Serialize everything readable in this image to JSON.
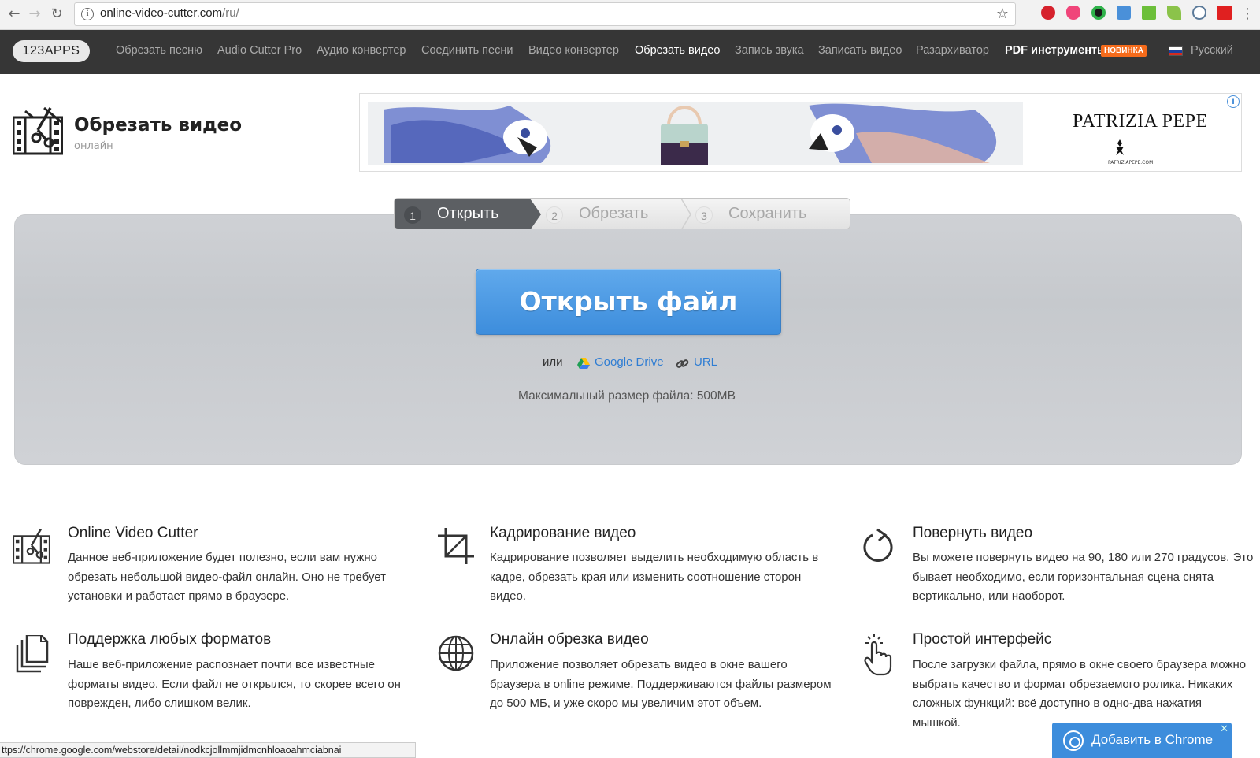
{
  "browser": {
    "url_host": "online-video-cutter.com",
    "url_path": "/ru/"
  },
  "sitenav": {
    "logo": "123APPS",
    "links": [
      "Обрезать песню",
      "Audio Cutter Pro",
      "Аудио конвертер",
      "Соединить песни",
      "Видео конвертер",
      "Обрезать видео",
      "Запись звука",
      "Записать видео",
      "Разархиватор",
      "PDF инструменты"
    ],
    "active_index": 5,
    "new_badge": "НОВИНКА",
    "language": "Русский"
  },
  "header": {
    "title": "Обрезать видео",
    "subtitle": "онлайн"
  },
  "ad": {
    "brand": "PATRIZIA PEPE",
    "brand_url": "PATRIZIAPEPE.COM"
  },
  "steps": [
    {
      "num": "1",
      "label": "Открыть"
    },
    {
      "num": "2",
      "label": "Обрезать"
    },
    {
      "num": "3",
      "label": "Сохранить"
    }
  ],
  "main": {
    "open_button": "Открыть файл",
    "or": "или",
    "google_drive": "Google Drive",
    "url": "URL",
    "max_size": "Максимальный размер файла: 500MB"
  },
  "features": [
    {
      "title": "Online Video Cutter",
      "icon": "film-scissors-icon",
      "text": "Данное веб-приложение будет полезно, если вам нужно обрезать небольшой видео-файл онлайн. Оно не требует установки и работает прямо в браузере."
    },
    {
      "title": "Кадрирование видео",
      "icon": "crop-icon",
      "text": "Кадрирование позволяет выделить необходимую область в кадре, обрезать края или изменить соотношение сторон видео."
    },
    {
      "title": "Повернуть видео",
      "icon": "rotate-icon",
      "text": "Вы можете повернуть видео на 90, 180 или 270 градусов. Это бывает необходимо, если горизонтальная сцена снята вертикально, или наоборот."
    },
    {
      "title": "Поддержка любых форматов",
      "icon": "files-icon",
      "text": "Наше веб-приложение распознает почти все известные форматы видео. Если файл не открылся, то скорее всего он поврежден, либо слишком велик."
    },
    {
      "title": "Онлайн обрезка видео",
      "icon": "globe-icon",
      "text": "Приложение позволяет обрезать видео в окне вашего браузера в online режиме. Поддерживаются файлы размером до 500 МБ, и уже скоро мы увеличим этот объем."
    },
    {
      "title": "Простой интерфейс",
      "icon": "pointer-hand-icon",
      "text": "После загрузки файла, прямо в окне своего браузера можно выбрать качество и формат обрезаемого ролика. Никаких сложных функций: всё доступно в одно-два нажатия мышкой."
    }
  ],
  "statusbar": "ttps://chrome.google.com/webstore/detail/nodkcjollmmjidmcnhloaoahmciabnai",
  "chrome_button": "Добавить в Chrome"
}
